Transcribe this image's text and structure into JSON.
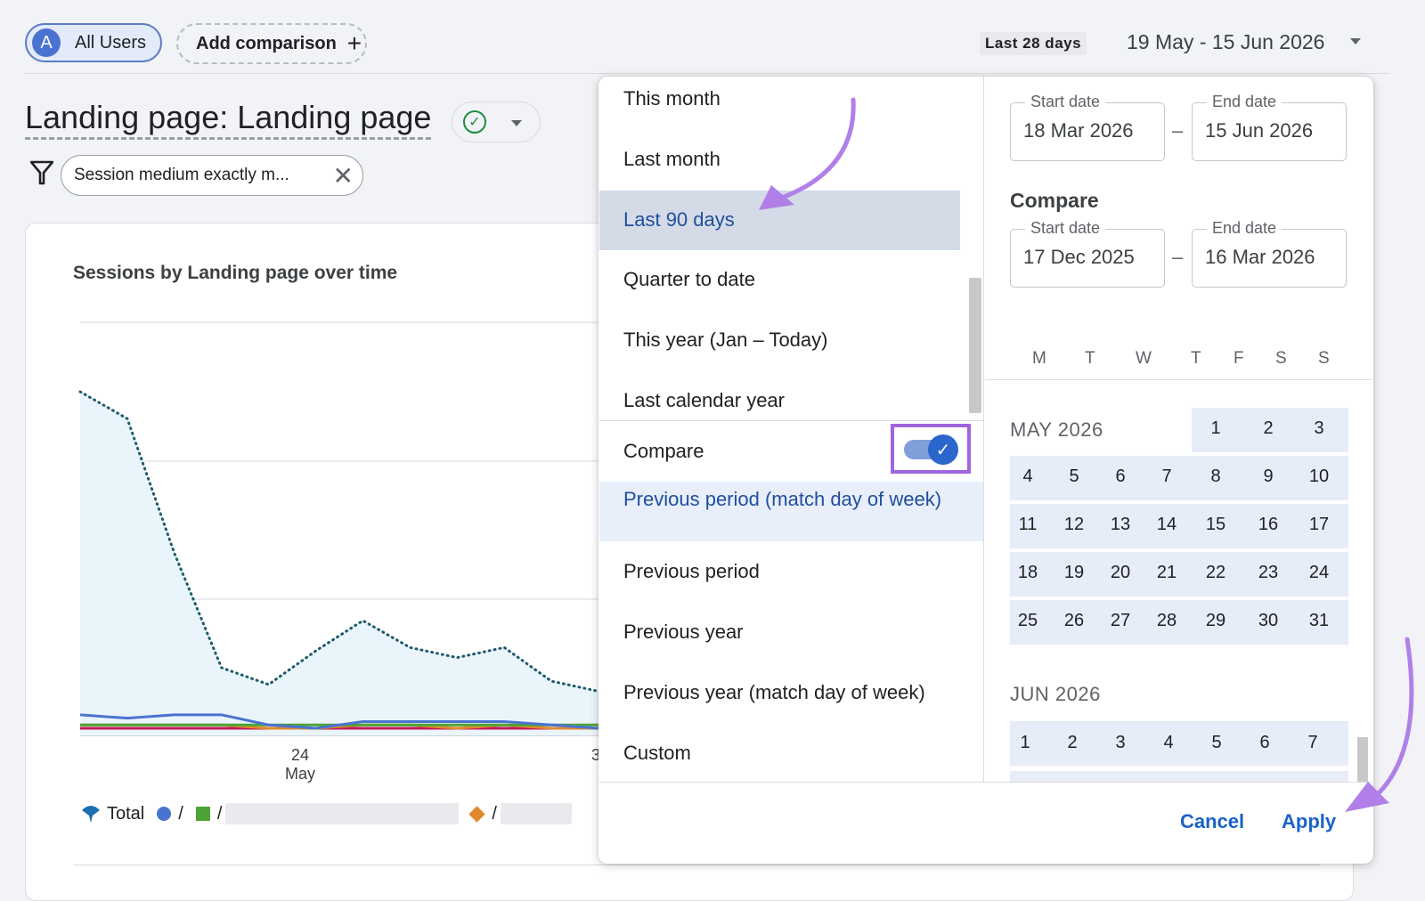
{
  "header": {
    "segment_avatar": "A",
    "segment_label": "All Users",
    "add_comparison": "Add comparison",
    "range_badge": "Last 28 days",
    "range_text": "19 May - 15 Jun 2026"
  },
  "page": {
    "title": "Landing page: Landing page",
    "filter": "Session medium exactly m..."
  },
  "chart": {
    "title": "Sessions by Landing page over time",
    "x_tick_day": "24",
    "x_tick_month": "May",
    "x_tick_partial": "3"
  },
  "legend": {
    "total": "Total",
    "sep": "/"
  },
  "chart_data": {
    "type": "line",
    "title": "Sessions by Landing page over time",
    "x_ticks": [
      "24 May",
      "3"
    ],
    "series": [
      {
        "name": "Total",
        "style": "dotted-area",
        "color": "#1e5b6b",
        "values": [
          100,
          92,
          52,
          18,
          13,
          23,
          32,
          24,
          21,
          24,
          14,
          11
        ]
      },
      {
        "color": "#4a73d1",
        "values": [
          4,
          3,
          4,
          4,
          1,
          0,
          2,
          2,
          2,
          2,
          1,
          0
        ]
      },
      {
        "color": "#4ea336",
        "values": [
          1,
          1,
          1,
          1,
          1,
          1,
          1,
          1,
          1,
          1,
          1,
          1
        ]
      },
      {
        "color": "#e08a2e",
        "values": [
          1,
          1,
          1,
          1,
          0,
          0,
          1,
          1,
          0,
          1,
          0,
          0
        ]
      },
      {
        "color": "#c2185b",
        "values": [
          0,
          0,
          0,
          0,
          0,
          0,
          0,
          0,
          0,
          0,
          0,
          0
        ]
      }
    ]
  },
  "dropdown": {
    "options": [
      "This month",
      "Last month",
      "Last 90 days",
      "Quarter to date",
      "This year (Jan – Today)",
      "Last calendar year"
    ],
    "compare_label": "Compare",
    "compare_options": [
      "Previous period (match day of week)",
      "Previous period",
      "Previous year",
      "Previous year (match day of week)",
      "Custom"
    ],
    "range": {
      "start_label": "Start date",
      "start": "18 Mar 2026",
      "end_label": "End date",
      "end": "15 Jun 2026"
    },
    "compare_heading": "Compare",
    "compare_range": {
      "start_label": "Start date",
      "start": "17 Dec 2025",
      "end_label": "End date",
      "end": "16 Mar 2026"
    },
    "dash": "–",
    "weekdays": [
      "M",
      "T",
      "W",
      "T",
      "F",
      "S",
      "S"
    ],
    "months": [
      {
        "name": "MAY 2026",
        "rows": [
          [
            "",
            "",
            "",
            "",
            "1",
            "2",
            "3"
          ],
          [
            "4",
            "5",
            "6",
            "7",
            "8",
            "9",
            "10"
          ],
          [
            "11",
            "12",
            "13",
            "14",
            "15",
            "16",
            "17"
          ],
          [
            "18",
            "19",
            "20",
            "21",
            "22",
            "23",
            "24"
          ],
          [
            "25",
            "26",
            "27",
            "28",
            "29",
            "30",
            "31"
          ]
        ]
      },
      {
        "name": "JUN 2026",
        "rows": [
          [
            "1",
            "2",
            "3",
            "4",
            "5",
            "6",
            "7"
          ]
        ]
      }
    ],
    "cancel": "Cancel",
    "apply": "Apply"
  },
  "colors": {
    "accent": "#1a62c9",
    "highlight_box": "#a064e0",
    "annotation_arrow": "#b07fe8"
  }
}
